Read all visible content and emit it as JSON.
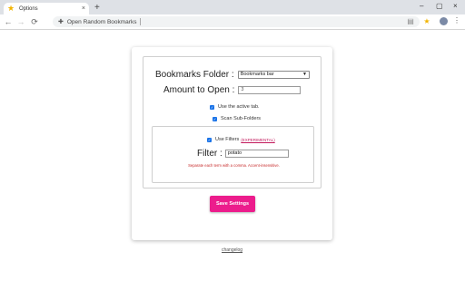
{
  "browser": {
    "tab_title": "Options",
    "tab_close": "×",
    "new_tab": "+",
    "address_text": "Open Random Bookmarks",
    "window_controls": {
      "minimize": "–",
      "maximize": "▢",
      "close": "×"
    },
    "icons": {
      "favicon": "star-icon",
      "back": "back-arrow-icon",
      "forward": "forward-arrow-icon",
      "reload": "reload-icon",
      "extension": "puzzle-icon",
      "bookmark": "bookmark-star-icon",
      "profile": "avatar"
    }
  },
  "options": {
    "folder_label": "Bookmarks Folder :",
    "folder_value": "Bookmarks bar",
    "amount_label": "Amount to Open :",
    "amount_value": "3",
    "active_tab_label": "Use the active tab.",
    "active_tab_checked": true,
    "scan_sub_label": "Scan Sub-Folders",
    "scan_sub_checked": true,
    "use_filters_label": "Use Filters",
    "use_filters_tag": "(EXPERIMENTAL)",
    "use_filters_checked": true,
    "filter_label": "Filter :",
    "filter_value": "potato",
    "filter_hint": "Separate each term with a comma. Accent-insensitive.",
    "save_label": "Save Settings"
  },
  "footer": {
    "changelog_label": "changelog"
  },
  "colors": {
    "accent": "#ec1c8c",
    "checkbox": "#1a73e8",
    "experimental": "#c2185b"
  }
}
